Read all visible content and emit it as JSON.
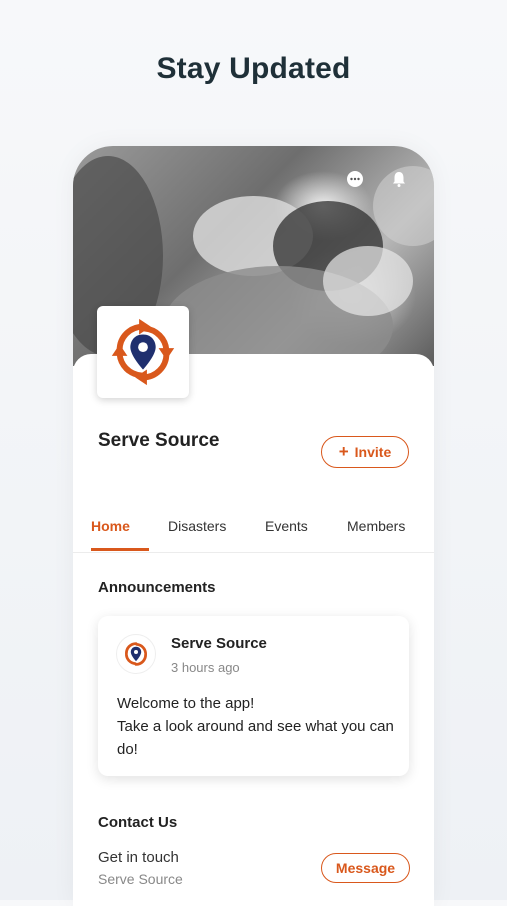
{
  "headline": "Stay Updated",
  "cover": {
    "chat_icon": "chat-bubble-icon",
    "notification_icon": "bell-icon"
  },
  "group": {
    "name": "Serve Source",
    "invite_label": "Invite",
    "invite_icon": "plus-icon"
  },
  "tabs": [
    {
      "label": "Home",
      "active": true
    },
    {
      "label": "Disasters",
      "active": false
    },
    {
      "label": "Events",
      "active": false
    },
    {
      "label": "Members",
      "active": false
    }
  ],
  "announcements": {
    "title": "Announcements",
    "post": {
      "author": "Serve Source",
      "time": "3 hours ago",
      "line1": "Welcome to the app!",
      "line2": "Take a look around and see what you can do!"
    }
  },
  "contact": {
    "title": "Contact Us",
    "line1": "Get in touch",
    "line2": "Serve Source",
    "button_label": "Message"
  },
  "colors": {
    "accent": "#d9581c",
    "logo_blue": "#1f2f6e",
    "headline": "#1f3038"
  }
}
